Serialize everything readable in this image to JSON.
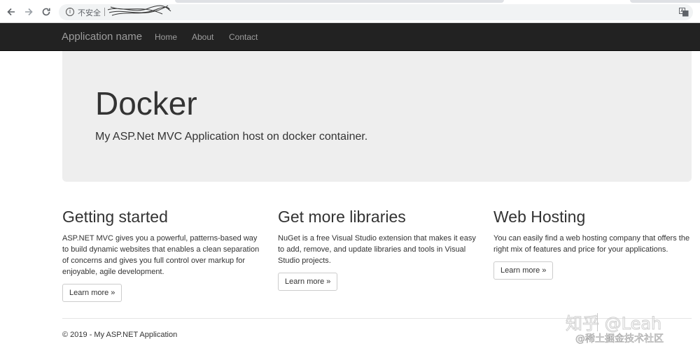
{
  "browser": {
    "insecure_label": "不安全",
    "info_glyph": "i",
    "accent": "#5f6368"
  },
  "navbar": {
    "brand": "Application name",
    "links": [
      "Home",
      "About",
      "Contact"
    ],
    "background": "#222222",
    "link_color": "#9d9d9d"
  },
  "jumbotron": {
    "title": "Docker",
    "lead": "My ASP.Net MVC Application host on docker container.",
    "background": "#eeeeee"
  },
  "columns": [
    {
      "heading": "Getting started",
      "body": "ASP.NET MVC gives you a powerful, patterns-based way to build dynamic websites that enables a clean separation of concerns and gives you full control over markup for enjoyable, agile development.",
      "button": "Learn more »"
    },
    {
      "heading": "Get more libraries",
      "body": "NuGet is a free Visual Studio extension that makes it easy to add, remove, and update libraries and tools in Visual Studio projects.",
      "button": "Learn more »"
    },
    {
      "heading": "Web Hosting",
      "body": "You can easily find a web hosting company that offers the right mix of features and price for your applications.",
      "button": "Learn more »"
    }
  ],
  "footer": {
    "text": "© 2019 - My ASP.NET Application"
  },
  "watermark": {
    "line1": "知乎 @Leah",
    "line2": "@稀土掘金技术社区"
  },
  "icons": [
    "back-arrow-icon",
    "forward-arrow-icon",
    "reload-icon",
    "info-icon",
    "translate-icon"
  ]
}
